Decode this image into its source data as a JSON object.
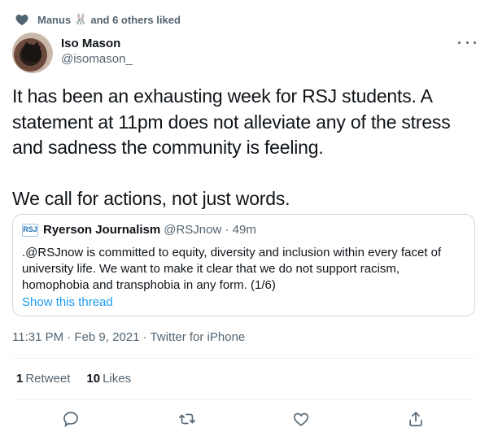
{
  "social_context": {
    "liker_name": "Manus",
    "liker_emoji": "🐰",
    "suffix": "and 6 others liked"
  },
  "author": {
    "name": "Iso Mason",
    "handle": "@isomason_"
  },
  "tweet": {
    "paragraph1": "It has been an exhausting week for RSJ students. A statement at 11pm does not alleviate any of the stress and sadness the community is feeling.",
    "paragraph2": "We call for actions, not just words."
  },
  "quoted_tweet": {
    "logo_text": "RSJ",
    "name": "Ryerson Journalism",
    "handle_time": "@RSJnow · 49m",
    "text": ".@RSJnow is committed to equity, diversity and inclusion within every facet of university life. We want to make it clear that we do not support racism, homophobia and transphobia in any form. (1/6)",
    "thread_link": "Show this thread"
  },
  "meta": {
    "timestamp": "11:31 PM · Feb 9, 2021 · Twitter for iPhone"
  },
  "stats": {
    "retweets_count": "1",
    "retweets_label": "Retweet",
    "likes_count": "10",
    "likes_label": "Likes"
  },
  "actions": {
    "icons": [
      "reply-icon",
      "retweet-icon",
      "like-icon",
      "share-icon"
    ]
  },
  "colors": {
    "text": "#0f1419",
    "secondary": "#536471",
    "link": "#1d9bf0",
    "border": "#cfd9de"
  }
}
